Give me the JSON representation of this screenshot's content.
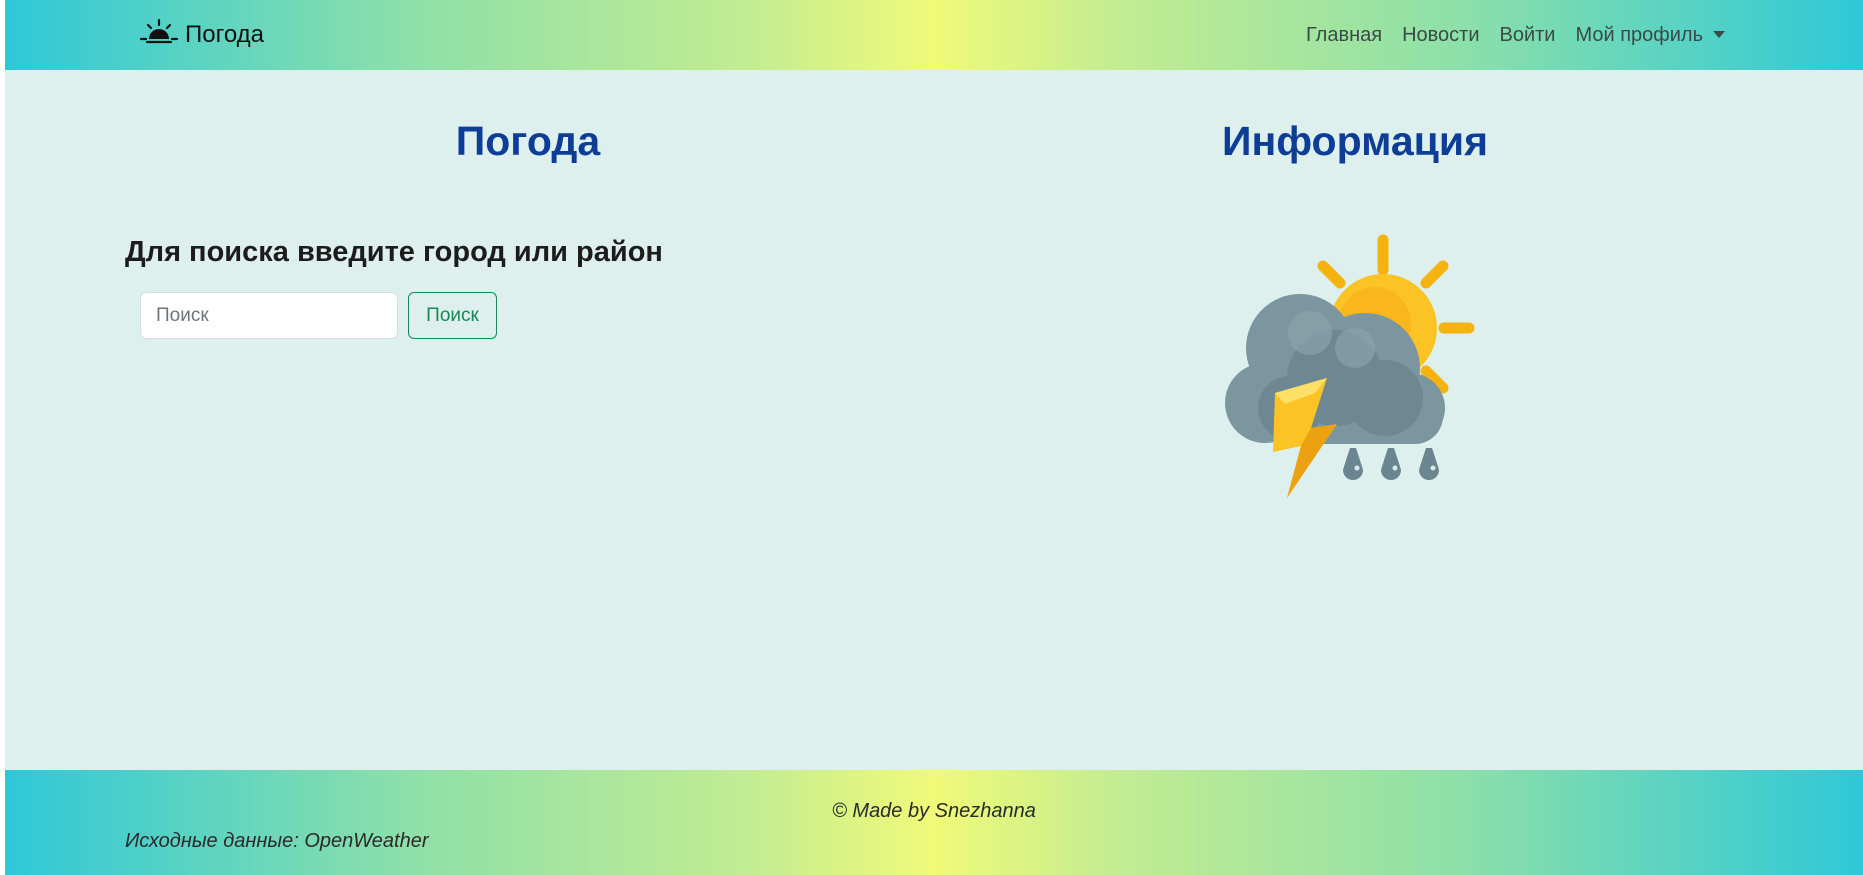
{
  "navbar": {
    "brand_label": "Погода",
    "brand_icon": "sunrise-icon",
    "links": [
      {
        "label": "Главная"
      },
      {
        "label": "Новости"
      },
      {
        "label": "Войти"
      },
      {
        "label": "Мой профиль"
      }
    ]
  },
  "main": {
    "left_title": "Погода",
    "right_title": "Информация",
    "search_heading": "Для поиска введите город или район",
    "search": {
      "placeholder": "Поиск",
      "value": "",
      "button_label": "Поиск"
    },
    "illustration": "thunderstorm-sun-cloud-icon"
  },
  "footer": {
    "copyright": "© Made by Snezhanna",
    "source": "Исходные данные: OpenWeather"
  },
  "colors": {
    "background": "#ddf0ee",
    "title": "#0d3d96",
    "accent_green": "#198754",
    "gradient_edge": "#2ec8d9",
    "gradient_center": "#f0fa78"
  }
}
